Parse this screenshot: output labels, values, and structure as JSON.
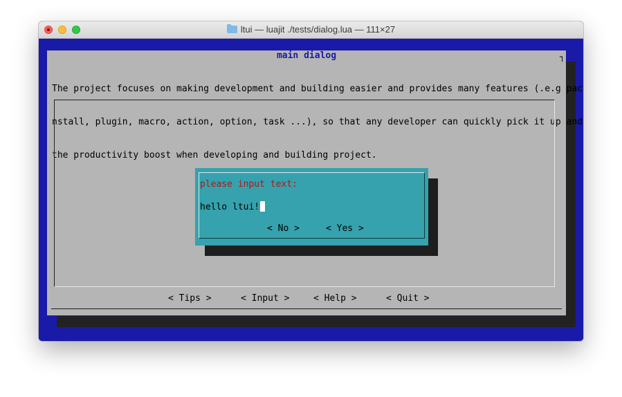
{
  "window": {
    "title": "ltui — luajit ./tests/dialog.lua — 111×27",
    "icon": "folder-icon"
  },
  "main_dialog": {
    "title": "main dialog",
    "description": [
      "The project focuses on making development and building easier and provides many features (.e.g package, i",
      "nstall, plugin, macro, action, option, task ...), so that any developer can quickly pick it up and enjoy",
      "the productivity boost when developing and building project."
    ],
    "buttons": {
      "tips": "< Tips >",
      "input": "< Input >",
      "help": "< Help >",
      "quit": "< Quit >"
    }
  },
  "input_dialog": {
    "prompt": "please input text:",
    "value": "hello ltui!",
    "buttons": {
      "no": "< No >",
      "yes": "< Yes >"
    }
  },
  "colors": {
    "terminal_bg": "#1a1aa8",
    "panel_bg": "#b5b5b5",
    "dialog_bg": "#35a2ad",
    "prompt_text": "#b01818",
    "title_text": "#1a1aa8",
    "shadow": "#222222"
  }
}
